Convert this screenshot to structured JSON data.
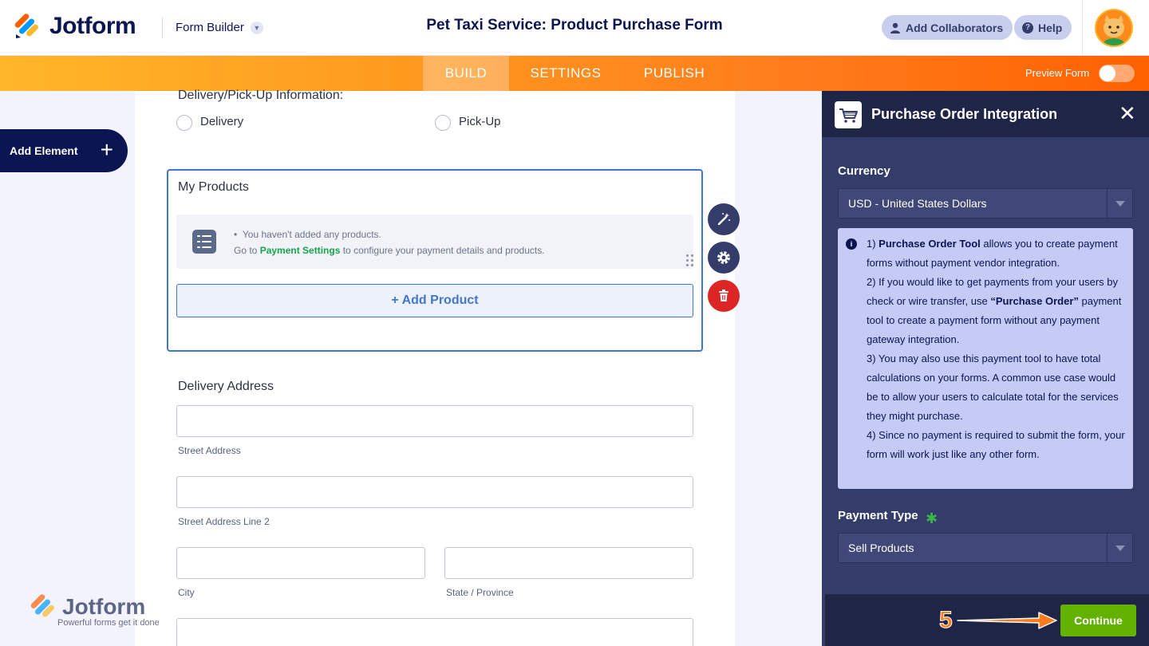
{
  "header": {
    "logo_text": "Jotform",
    "builder_label": "Form Builder",
    "form_title": "Pet Taxi Service: Product Purchase Form",
    "add_collaborators": "Add Collaborators",
    "help": "Help"
  },
  "nav": {
    "tabs": [
      {
        "label": "BUILD",
        "active": true
      },
      {
        "label": "SETTINGS",
        "active": false
      },
      {
        "label": "PUBLISH",
        "active": false
      }
    ],
    "preview_label": "Preview Form",
    "preview_on": false
  },
  "sidebar": {
    "add_element_label": "Add Element"
  },
  "form": {
    "delivery_question": "Delivery/Pick-Up Information:",
    "options": [
      "Delivery",
      "Pick-Up"
    ],
    "products": {
      "title": "My Products",
      "empty_line1": "You haven't added any products.",
      "empty_line2_prefix": "Go to ",
      "empty_line2_link": "Payment Settings",
      "empty_line2_suffix": " to configure your payment details and products.",
      "add_button": "+ Add Product"
    },
    "address": {
      "title": "Delivery Address",
      "street": "Street Address",
      "street2": "Street Address Line 2",
      "city": "City",
      "state": "State / Province"
    }
  },
  "watermark": {
    "text": "Jotform",
    "tagline": "Powerful forms get it done"
  },
  "panel": {
    "title": "Purchase Order Integration",
    "currency_label": "Currency",
    "currency_value": "USD - United States Dollars",
    "info": {
      "p1_prefix": "1) ",
      "p1_bold": "Purchase Order Tool",
      "p1_rest": " allows you to create payment forms without payment vendor integration.",
      "p2_prefix": "2) If you would like to get payments from your users by check or wire transfer, use ",
      "p2_bold": "“Purchase Order”",
      "p2_rest": " payment tool to create a payment form without any payment gateway integration.",
      "p3": "3) You may also use this payment tool to have total calculations on your forms. A common use case would be to allow your users to calculate total for the services they might purchase.",
      "p4": "4) Since no payment is required to submit the form, your form will work just like any other form."
    },
    "payment_type_label": "Payment Type",
    "required_mark": "✱",
    "payment_type_value": "Sell Products",
    "continue_label": "Continue"
  },
  "annotation": {
    "step_number": "5"
  },
  "colors": {
    "brand_navy": "#0a1551",
    "accent_orange": "#ff7b1c",
    "active_border": "#4277cb",
    "continue_green": "#64b200",
    "delete_red": "#dc2626"
  }
}
